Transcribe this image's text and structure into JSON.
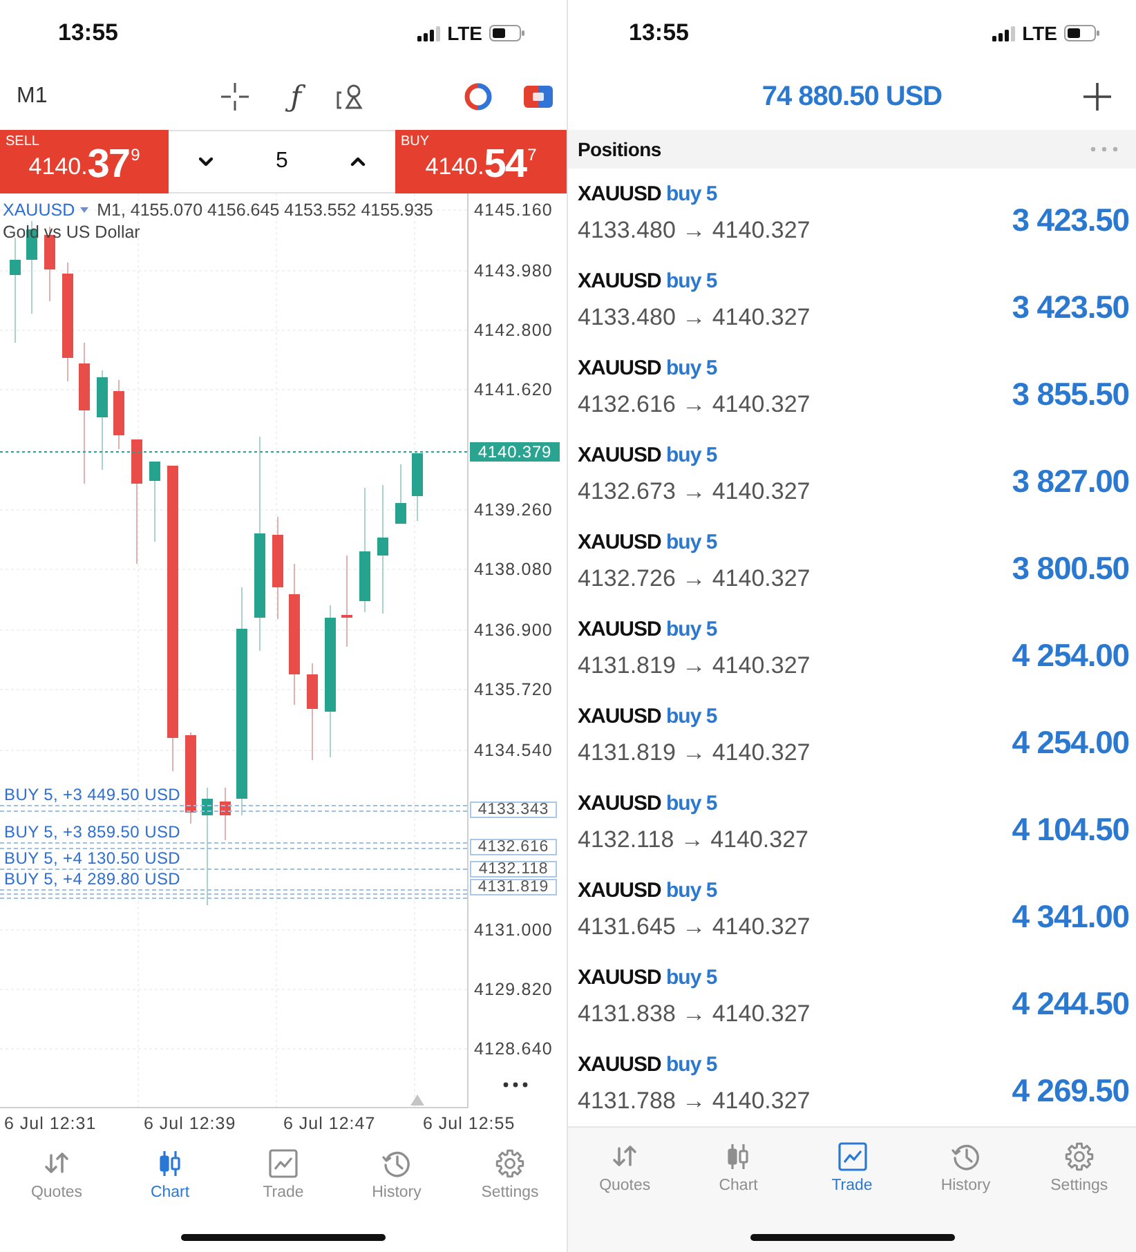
{
  "chart_screen": {
    "status_bar": {
      "time": "13:55",
      "network": "LTE"
    },
    "toolbar": {
      "timeframe": "M1",
      "indicators_glyph": "ƒ"
    },
    "trade_panel": {
      "sell": {
        "label": "SELL",
        "price": "4140.",
        "pips": "37",
        "point": "9"
      },
      "volume": "5",
      "buy": {
        "label": "BUY",
        "price": "4140.",
        "pips": "54",
        "point": "7"
      }
    },
    "chart": {
      "symbol": "XAUUSD",
      "info": "M1, 4155.070 4156.645 4153.552 4155.935",
      "description": "Gold vs US Dollar",
      "price_labels": [
        "4145.160",
        "4143.980",
        "4142.800",
        "4141.620",
        "4139.260",
        "4138.080",
        "4136.900",
        "4135.720",
        "4134.540",
        "4131.000",
        "4129.820",
        "4128.640"
      ],
      "current_price": "4140.379",
      "order_lines": [
        {
          "label": "BUY 5, +3 449.50 USD",
          "price": "4133.343"
        },
        {
          "label": "BUY 5, +3 859.50 USD",
          "price": "4132.616"
        },
        {
          "label": "BUY 5, +4 130.50 USD",
          "price": "4132.118"
        },
        {
          "label": "BUY 5, +4 289.80 USD",
          "price": "4131.819"
        }
      ],
      "time_labels": [
        "6 Jul 12:31",
        "6 Jul 12:39",
        "6 Jul 12:47",
        "6 Jul 12:55"
      ]
    },
    "tab_bar": [
      {
        "kind": "quotes",
        "label": "Quotes",
        "selected": false
      },
      {
        "kind": "chart",
        "label": "Chart",
        "selected": true
      },
      {
        "kind": "trade",
        "label": "Trade",
        "selected": false
      },
      {
        "kind": "history",
        "label": "History",
        "selected": false
      },
      {
        "kind": "settings",
        "label": "Settings",
        "selected": false
      }
    ]
  },
  "positions_screen": {
    "status_bar": {
      "time": "13:55",
      "network": "LTE"
    },
    "balance": "74 880.50 USD",
    "section_title": "Positions",
    "positions": [
      {
        "symbol": "XAUUSD",
        "side": "buy 5",
        "prices": "4133.480 → 4140.327",
        "profit": "3 423.50"
      },
      {
        "symbol": "XAUUSD",
        "side": "buy 5",
        "prices": "4133.480 → 4140.327",
        "profit": "3 423.50"
      },
      {
        "symbol": "XAUUSD",
        "side": "buy 5",
        "prices": "4132.616 → 4140.327",
        "profit": "3 855.50"
      },
      {
        "symbol": "XAUUSD",
        "side": "buy 5",
        "prices": "4132.673 → 4140.327",
        "profit": "3 827.00"
      },
      {
        "symbol": "XAUUSD",
        "side": "buy 5",
        "prices": "4132.726 → 4140.327",
        "profit": "3 800.50"
      },
      {
        "symbol": "XAUUSD",
        "side": "buy 5",
        "prices": "4131.819 → 4140.327",
        "profit": "4 254.00"
      },
      {
        "symbol": "XAUUSD",
        "side": "buy 5",
        "prices": "4131.819 → 4140.327",
        "profit": "4 254.00"
      },
      {
        "symbol": "XAUUSD",
        "side": "buy 5",
        "prices": "4132.118 → 4140.327",
        "profit": "4 104.50"
      },
      {
        "symbol": "XAUUSD",
        "side": "buy 5",
        "prices": "4131.645 → 4140.327",
        "profit": "4 341.00"
      },
      {
        "symbol": "XAUUSD",
        "side": "buy 5",
        "prices": "4131.838 → 4140.327",
        "profit": "4 244.50"
      },
      {
        "symbol": "XAUUSD",
        "side": "buy 5",
        "prices": "4131.788 → 4140.327",
        "profit": "4 269.50"
      }
    ],
    "tab_bar": [
      {
        "kind": "quotes",
        "label": "Quotes",
        "selected": false
      },
      {
        "kind": "chart",
        "label": "Chart",
        "selected": false
      },
      {
        "kind": "trade",
        "label": "Trade",
        "selected": true
      },
      {
        "kind": "history",
        "label": "History",
        "selected": false
      },
      {
        "kind": "settings",
        "label": "Settings",
        "selected": false
      }
    ]
  }
}
